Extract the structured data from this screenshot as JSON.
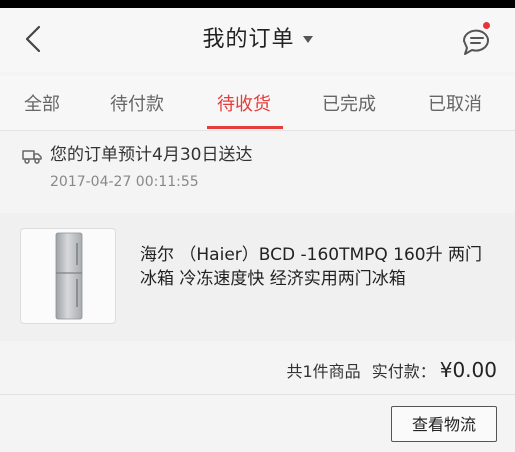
{
  "header": {
    "title": "我的订单",
    "back_icon": "chevron-left-icon",
    "message_icon": "chat-bubble-icon",
    "notification_dot_color": "#e8333a"
  },
  "tabs": [
    {
      "label": "全部",
      "active": false
    },
    {
      "label": "待付款",
      "active": false
    },
    {
      "label": "待收货",
      "active": true
    },
    {
      "label": "已完成",
      "active": false
    },
    {
      "label": "已取消",
      "active": false
    }
  ],
  "accent_color": "#e63c3c",
  "order": {
    "delivery_text": "您的订单预计4月30日送达",
    "delivery_icon": "truck-icon",
    "timestamp": "2017-04-27 00:11:55",
    "product": {
      "name": "海尔 （Haier）BCD -160TMPQ 160升 两门冰箱 冷冻速度快 经济实用两门冰箱",
      "image_icon": "refrigerator-icon"
    },
    "summary": {
      "count_label": "共1件商品",
      "paid_label": "实付款：",
      "price": "¥0.00"
    },
    "actions": {
      "logistics_label": "查看物流"
    }
  }
}
